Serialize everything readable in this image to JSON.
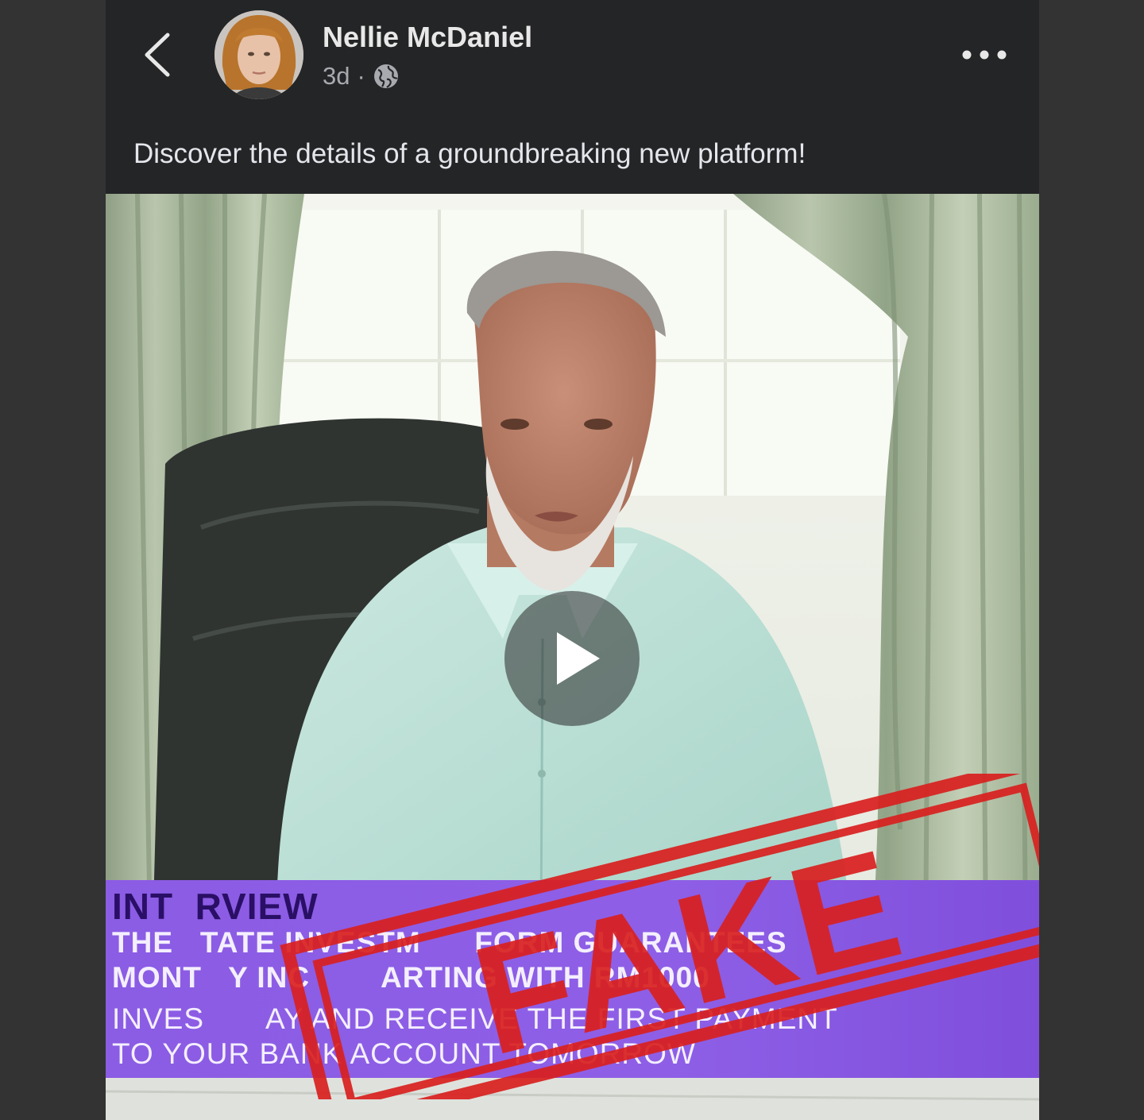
{
  "post": {
    "author": "Nellie McDaniel",
    "time": "3d",
    "separator": "·",
    "audience_icon": "globe-icon",
    "text": "Discover the details of a groundbreaking new platform!"
  },
  "video": {
    "overlay": {
      "line1": "INT  RVIEW",
      "line2": "THE   TATE INVESTM      FORM GUARANTEES",
      "line3": "MONT   Y INC        ARTING WITH RM1000",
      "line4": "INVES       AY AND RECEIVE THE FIRST PAYMENT",
      "line5": "TO YOUR BANK ACCOUNT TOMORROW"
    },
    "stamp_text": "FAKE"
  },
  "colors": {
    "background": "#333333",
    "card": "#242526",
    "banner": "#8b5ce4",
    "stamp": "#d9201f"
  }
}
